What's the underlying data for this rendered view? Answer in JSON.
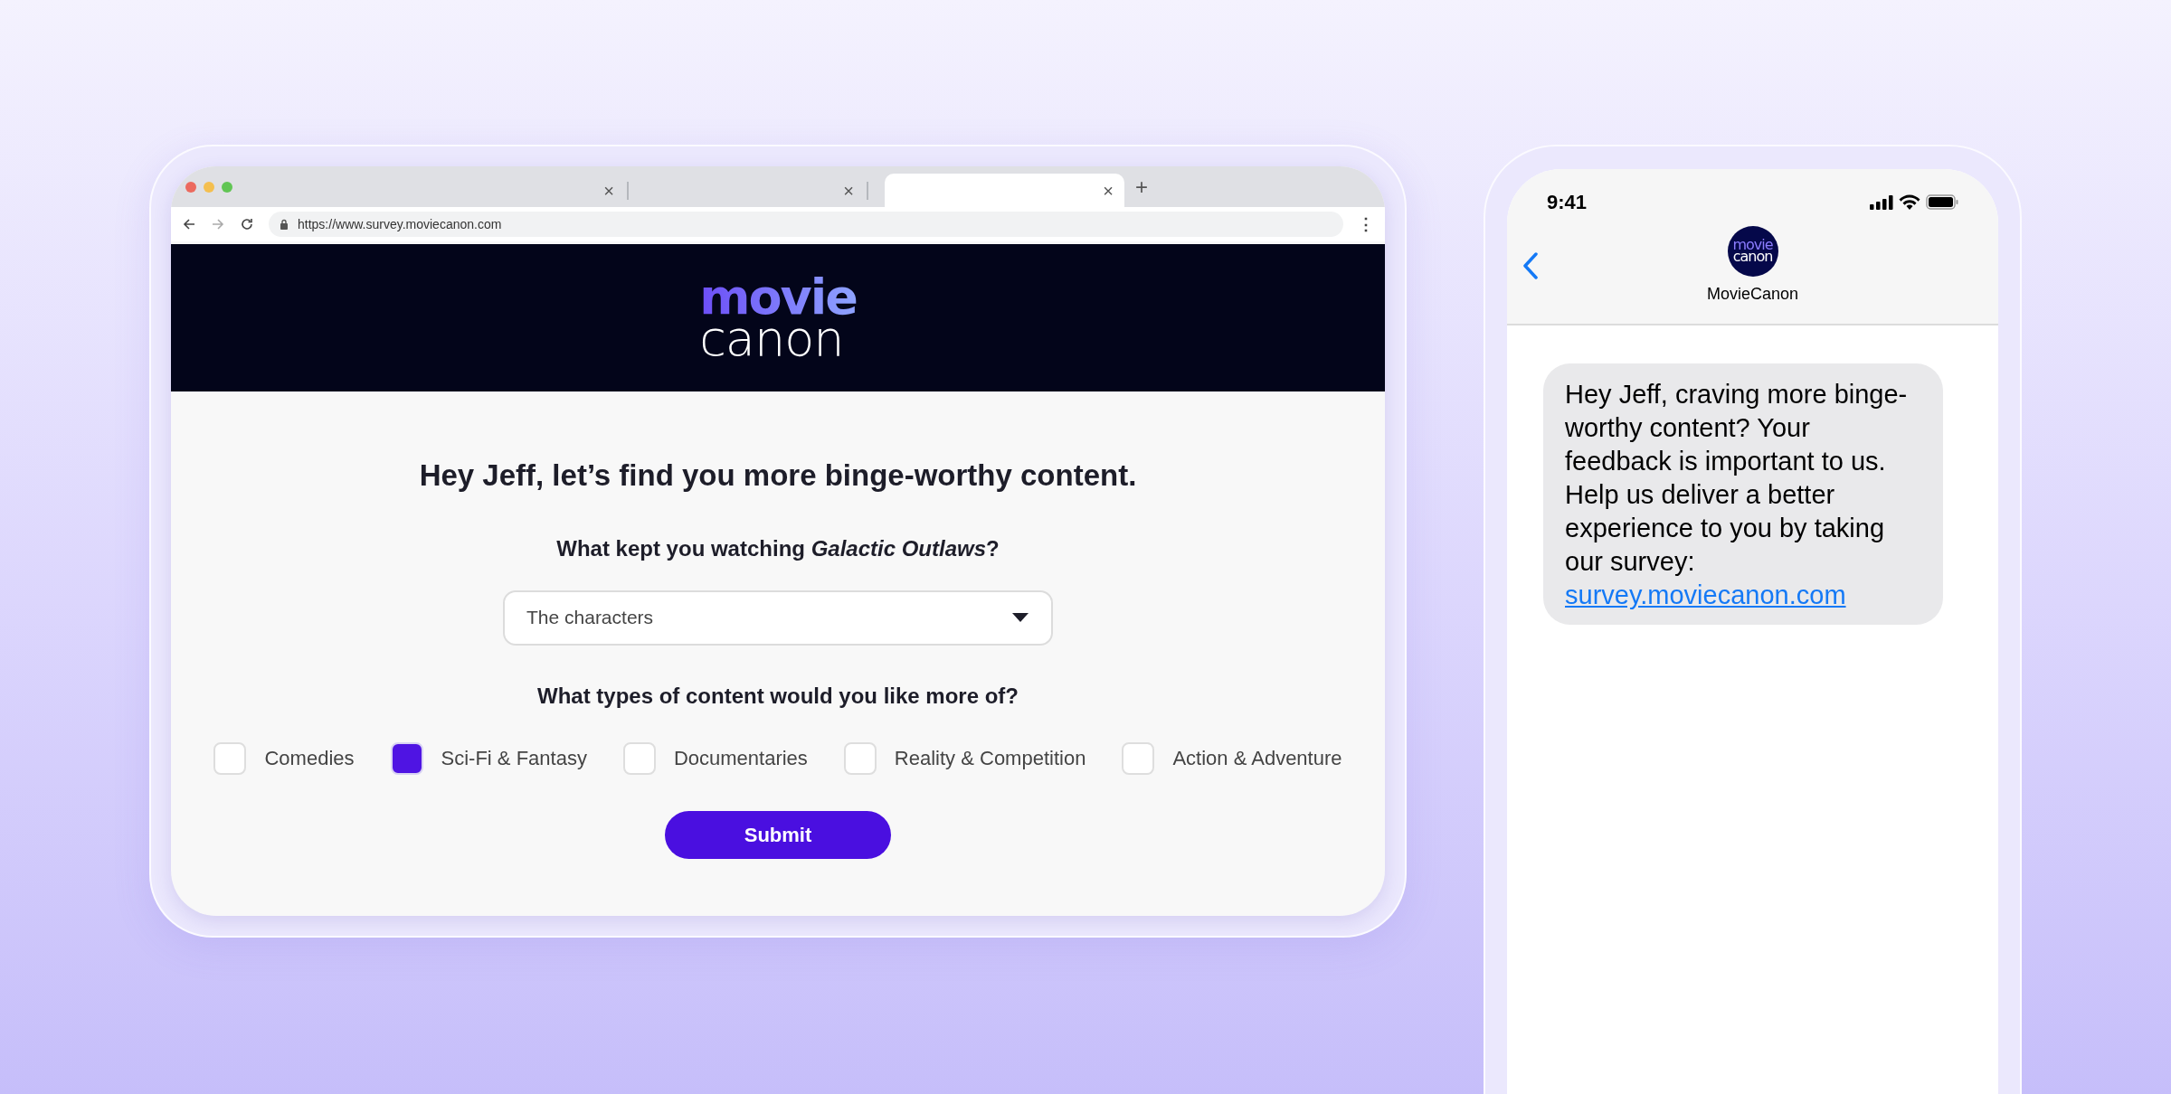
{
  "browser": {
    "tabs": [
      {
        "close": "×",
        "selected": false
      },
      {
        "close": "×",
        "selected": false
      },
      {
        "close": "×",
        "selected": true
      }
    ],
    "new_tab": "+",
    "address": "https://www.survey.moviecanon.com",
    "menu": "⋮"
  },
  "page": {
    "logo": [
      "movie",
      "canon"
    ],
    "headline": "Hey Jeff, let’s find you more binge-worthy content.",
    "question_1": "What kept you watching *Galactic Outlaws*?",
    "dropdown": {
      "value": "The characters"
    },
    "question_2": "What types of content would you like more of?",
    "options": [
      {
        "label": "Comedies",
        "checked": false
      },
      {
        "label": "Sci-Fi & Fantasy",
        "checked": true
      },
      {
        "label": "Documentaries",
        "checked": false
      },
      {
        "label": "Reality & Competition",
        "checked": false
      },
      {
        "label": "Action & Adventure",
        "checked": false
      }
    ],
    "submit": "Submit"
  },
  "phone": {
    "time": "9:41",
    "avatar": [
      "movie",
      "canon"
    ],
    "contact": "MovieCanon",
    "message": {
      "text": "Hey Jeff, craving more binge-worthy content? Your feedback is important to us. Help us deliver a better experience to you by taking our survey:",
      "link": "survey.moviecanon.com"
    }
  }
}
